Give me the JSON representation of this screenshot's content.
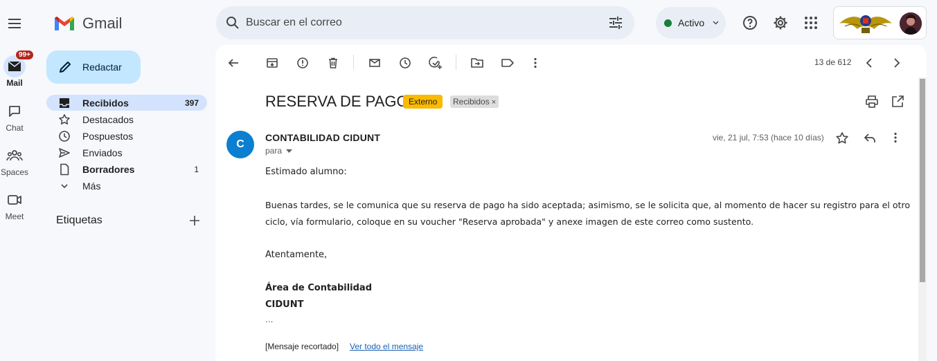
{
  "app": {
    "name": "Gmail"
  },
  "rail": {
    "items": [
      {
        "label": "Mail",
        "badge": "99+"
      },
      {
        "label": "Chat"
      },
      {
        "label": "Spaces"
      },
      {
        "label": "Meet"
      }
    ]
  },
  "search": {
    "placeholder": "Buscar en el correo"
  },
  "status": {
    "label": "Activo"
  },
  "compose": {
    "label": "Redactar"
  },
  "nav": {
    "items": [
      {
        "label": "Recibidos",
        "count": "397"
      },
      {
        "label": "Destacados",
        "count": ""
      },
      {
        "label": "Pospuestos",
        "count": ""
      },
      {
        "label": "Enviados",
        "count": ""
      },
      {
        "label": "Borradores",
        "count": "1"
      },
      {
        "label": "Más",
        "count": ""
      }
    ],
    "labels_title": "Etiquetas"
  },
  "toolbar": {
    "pager": "13 de 612"
  },
  "email": {
    "subject": "RESERVA DE PAGO",
    "tag_external": "Externo",
    "tag_label": "Recibidos",
    "tag_remove": "×",
    "avatar_initial": "C",
    "sender": "CONTABILIDAD CIDUNT",
    "to": "para",
    "date": "vie, 21 jul, 7:53 (hace 10 días)",
    "greeting": "Estimado alumno:",
    "paragraph_line1": "Buenas tardes, se le comunica que su reserva de pago ha sido aceptada; asimismo, se le solicita que, al momento de hacer su registro para el otro",
    "paragraph_line2": "ciclo, vía formulario, coloque en su voucher \"Reserva aprobada\" y anexe imagen de este correo como sustento.",
    "closing": "Atentamente,",
    "signature_line1": "Área de Contabilidad",
    "signature_line2": "CIDUNT",
    "ellipsis": "...",
    "clipped_text": "[Mensaje recortado]",
    "view_full_link": "Ver todo el mensaje"
  },
  "colors": {
    "accent": "#0b57d0",
    "compose_bg": "#c2e7ff",
    "active_nav": "#d3e3fd",
    "tag_external": "#f9ba00",
    "status_dot": "#188038"
  }
}
